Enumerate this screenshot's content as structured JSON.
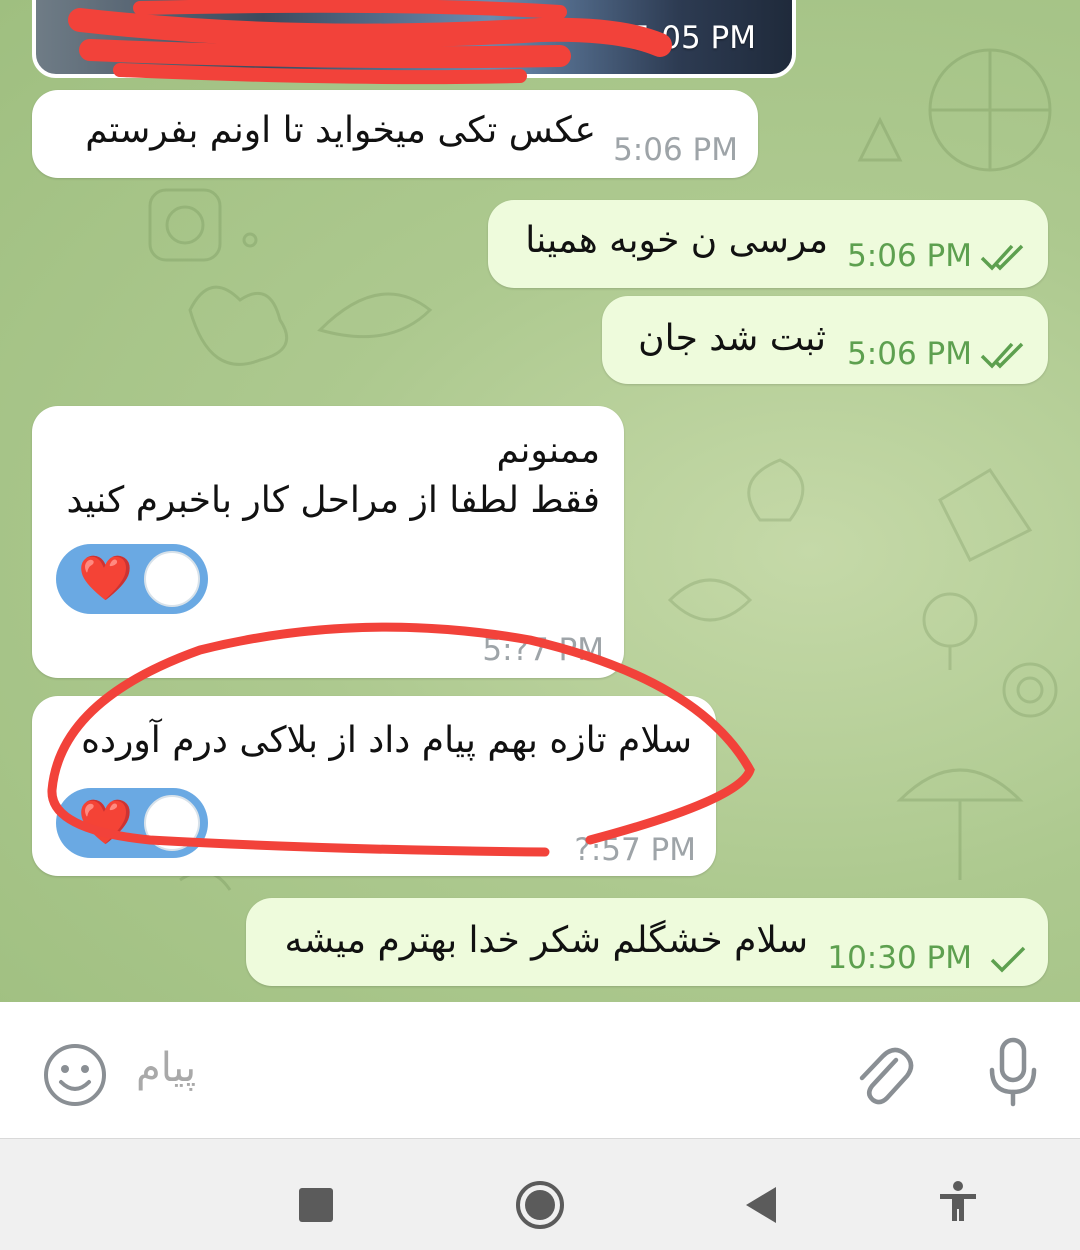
{
  "messages": [
    {
      "id": "photo",
      "direction": "incoming",
      "type": "photo",
      "time": "5:05 PM"
    },
    {
      "id": "m1",
      "direction": "incoming",
      "text": "عکس تکی میخواید تا اونم بفرستم",
      "time": "5:06 PM"
    },
    {
      "id": "m2",
      "direction": "outgoing",
      "text": "مرسی ن خوبه همینا",
      "time": "5:06 PM",
      "status": "read"
    },
    {
      "id": "m3",
      "direction": "outgoing",
      "text": "ثبت شد جان",
      "time": "5:06 PM",
      "status": "read"
    },
    {
      "id": "m4",
      "direction": "incoming",
      "line1": "ممنونم",
      "line2": "فقط لطفا از مراحل کار باخبرم کنید",
      "time": "5:?7 PM",
      "reaction": "❤️"
    },
    {
      "id": "m5",
      "direction": "incoming",
      "text": "سلام تازه بهم پیام داد از بلاکی درم آورده",
      "time": "?:57 PM",
      "reaction": "❤️"
    },
    {
      "id": "m6",
      "direction": "outgoing",
      "text": "سلام خشگلم شکر خدا بهترم میشه",
      "time": "10:30 PM",
      "status": "sent"
    }
  ],
  "composer": {
    "placeholder": "پیام"
  },
  "icons": {
    "emoji": "emoji-icon",
    "attach": "paperclip-icon",
    "mic": "microphone-icon",
    "nav_recents": "square-icon",
    "nav_home": "circle-icon",
    "nav_back": "triangle-back-icon",
    "nav_accessibility": "accessibility-icon"
  },
  "colors": {
    "incoming_bubble": "#ffffff",
    "outgoing_bubble": "#eefbdc",
    "outgoing_time": "#5da04f",
    "incoming_time": "#9ea4a8",
    "reaction_pill": "#6aa9e3",
    "annotation_red": "#f2423a"
  }
}
